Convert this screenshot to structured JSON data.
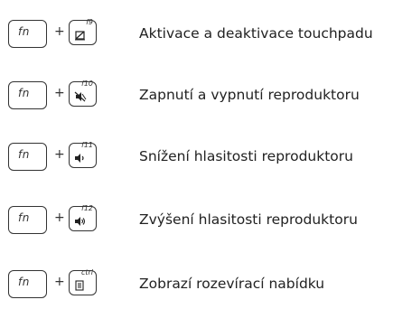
{
  "rows": [
    {
      "fn_label": "fn",
      "plus": "+",
      "key_label": "f9",
      "icon": "touchpad-icon",
      "description": "Aktivace a deaktivace touchpadu"
    },
    {
      "fn_label": "fn",
      "plus": "+",
      "key_label": "f10",
      "icon": "speaker-mute-icon",
      "description": "Zapnutí a vypnutí reproduktoru"
    },
    {
      "fn_label": "fn",
      "plus": "+",
      "key_label": "f11",
      "icon": "volume-down-icon",
      "description": "Snížení hlasitosti reproduktoru"
    },
    {
      "fn_label": "fn",
      "plus": "+",
      "key_label": "f12",
      "icon": "volume-up-icon",
      "description": "Zvýšení hlasitosti reproduktoru"
    },
    {
      "fn_label": "fn",
      "plus": "+",
      "key_label": "ctrl",
      "icon": "menu-icon",
      "description": "Zobrazí rozevírací nabídku"
    }
  ]
}
